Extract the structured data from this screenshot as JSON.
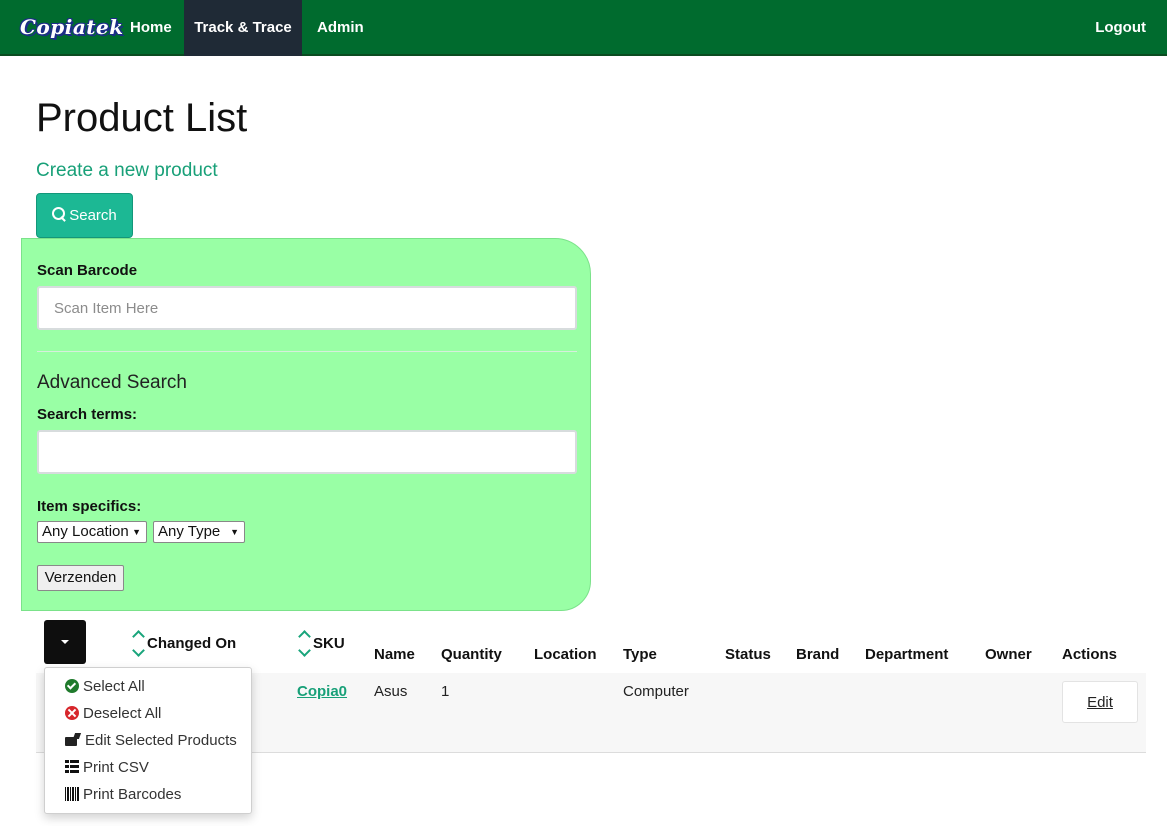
{
  "nav": {
    "brand": "Copiatek",
    "home": "Home",
    "track_trace": "Track & Trace",
    "admin": "Admin",
    "logout": "Logout"
  },
  "page": {
    "title": "Product List",
    "create_link": "Create a new product",
    "search_button": "Search"
  },
  "search_panel": {
    "scan_label": "Scan Barcode",
    "scan_placeholder": "Scan Item Here",
    "advanced_title": "Advanced Search",
    "terms_label": "Search terms:",
    "terms_value": "",
    "specifics_label": "Item specifics:",
    "location_select": "Any Location",
    "type_select": "Any Type",
    "submit": "Verzenden"
  },
  "table": {
    "headers": {
      "changed_on": "Changed On",
      "sku": "SKU",
      "name": "Name",
      "quantity": "Quantity",
      "location": "Location",
      "type": "Type",
      "status": "Status",
      "brand": "Brand",
      "department": "Department",
      "owner": "Owner",
      "actions": "Actions"
    },
    "rows": [
      {
        "sku": "Copia0",
        "name": "Asus",
        "quantity": "1",
        "location": "",
        "type": "Computer",
        "status": "",
        "brand": "",
        "department": "",
        "owner": "",
        "action": "Edit"
      }
    ]
  },
  "bulk_menu": {
    "items": [
      {
        "label": "Select All",
        "icon": "check-circle-icon"
      },
      {
        "label": "Deselect All",
        "icon": "times-circle-icon"
      },
      {
        "label": "Edit Selected Products",
        "icon": "folder-open-icon"
      },
      {
        "label": "Print CSV",
        "icon": "list-icon"
      },
      {
        "label": "Print Barcodes",
        "icon": "barcode-icon"
      }
    ]
  },
  "colors": {
    "navbar": "#006b2e",
    "active_tab": "#1f2a36",
    "accent": "#1cb894",
    "panel": "#99ffa5",
    "link": "#18a078"
  }
}
